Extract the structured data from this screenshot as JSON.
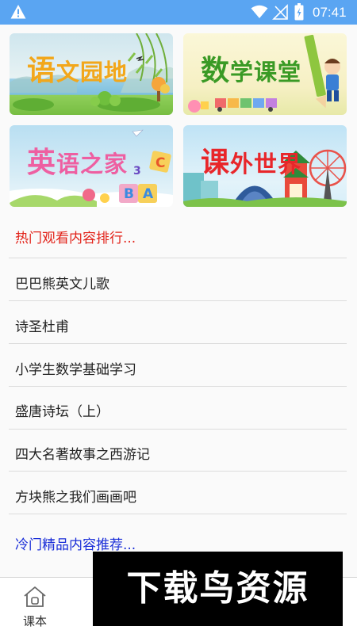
{
  "status_bar": {
    "time": "07:41"
  },
  "tiles": [
    {
      "label_first": "语",
      "label_rest": "文园地",
      "icon": "landscape-illustration"
    },
    {
      "label_first": "数",
      "label_rest": "学课堂",
      "icon": "pencil-boy-illustration"
    },
    {
      "label_first": "英",
      "label_rest": "语之家",
      "icon": "abc-blocks-illustration"
    },
    {
      "label_first": "课",
      "label_rest": "外世界",
      "icon": "city-ferris-wheel-illustration"
    }
  ],
  "hot": {
    "title": "热门观看内容排行...",
    "items": [
      "巴巴熊英文儿歌",
      "诗圣杜甫",
      "小学生数学基础学习",
      "盛唐诗坛（上）",
      "四大名著故事之西游记",
      "方块熊之我们画画吧"
    ]
  },
  "cold": {
    "title": "冷门精品内容推荐..."
  },
  "bottom_nav": {
    "home_label": "课本"
  },
  "watermark": {
    "text": "下载鸟资源"
  },
  "colors": {
    "status_bar": "#5aa5f2",
    "hot_title": "#e2231a",
    "cold_title": "#1a2ed8",
    "yuwen_label": "#f2a71b",
    "shuxue_label": "#3a9a25",
    "yingyu_label": "#ee5fa1",
    "kewai_label": "#e8262a"
  }
}
